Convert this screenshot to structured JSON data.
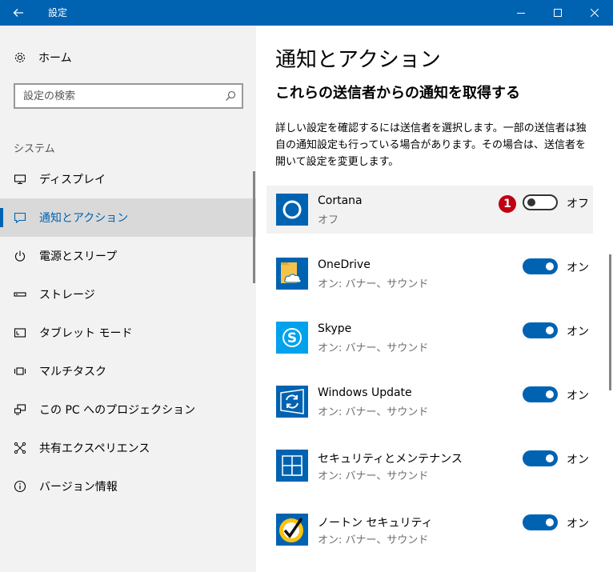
{
  "window": {
    "title": "設定"
  },
  "sidebar": {
    "home_label": "ホーム",
    "search_placeholder": "設定の検索",
    "section_label": "システム",
    "items": [
      {
        "label": "ディスプレイ",
        "icon": "monitor-icon"
      },
      {
        "label": "通知とアクション",
        "icon": "notification-icon",
        "active": true
      },
      {
        "label": "電源とスリープ",
        "icon": "power-icon"
      },
      {
        "label": "ストレージ",
        "icon": "storage-icon"
      },
      {
        "label": "タブレット モード",
        "icon": "tablet-icon"
      },
      {
        "label": "マルチタスク",
        "icon": "multitask-icon"
      },
      {
        "label": "この PC へのプロジェクション",
        "icon": "projection-icon"
      },
      {
        "label": "共有エクスペリエンス",
        "icon": "share-icon"
      },
      {
        "label": "バージョン情報",
        "icon": "info-icon"
      }
    ]
  },
  "main": {
    "title": "通知とアクション",
    "subtitle": "これらの送信者からの通知を取得する",
    "description": "詳しい設定を確認するには送信者を選択します。一部の送信者は独自の通知設定も行っている場合があります。その場合は、送信者を開いて設定を変更します。",
    "marker": "1",
    "senders": [
      {
        "name": "Cortana",
        "status": "オフ",
        "toggle": "オフ",
        "on": false,
        "icon": "cortana-icon"
      },
      {
        "name": "OneDrive",
        "status": "オン: バナー、サウンド",
        "toggle": "オン",
        "on": true,
        "icon": "onedrive-icon"
      },
      {
        "name": "Skype",
        "status": "オン: バナー、サウンド",
        "toggle": "オン",
        "on": true,
        "icon": "skype-icon"
      },
      {
        "name": "Windows Update",
        "status": "オン: バナー、サウンド",
        "toggle": "オン",
        "on": true,
        "icon": "windows-update-icon"
      },
      {
        "name": "セキュリティとメンテナンス",
        "status": "オン: バナー、サウンド",
        "toggle": "オン",
        "on": true,
        "icon": "security-maintenance-icon"
      },
      {
        "name": "ノートン セキュリティ",
        "status": "オン: バナー、サウンド",
        "toggle": "オン",
        "on": true,
        "icon": "norton-icon"
      }
    ]
  },
  "colors": {
    "accent": "#0063b1",
    "sidebar_bg": "#f2f2f2",
    "active_bg": "#d9d9d9",
    "marker": "#c00012"
  }
}
